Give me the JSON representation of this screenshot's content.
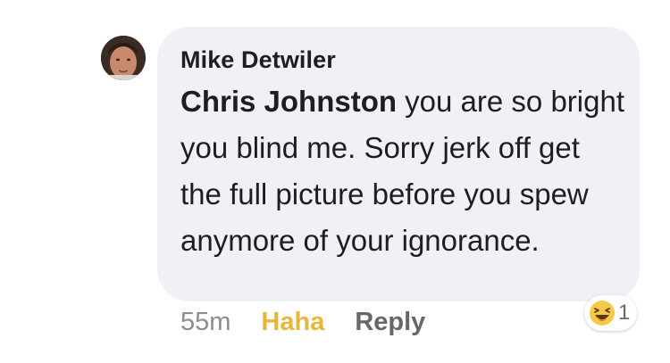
{
  "comment": {
    "author": "Mike Detwiler",
    "mention": "Chris Johnston",
    "text": " you are so bright you blind me. Sorry jerk off get the full picture before you spew anymore of your ignorance.",
    "timestamp": "55m",
    "reaction_label": "Haha",
    "reply_label": "Reply",
    "reaction_count": "1",
    "reaction_icon": "laughing-emoji-icon"
  },
  "colors": {
    "bubble": "#f0f1f4",
    "haha_accent": "#e8b73a",
    "secondary_text": "#65676b"
  }
}
